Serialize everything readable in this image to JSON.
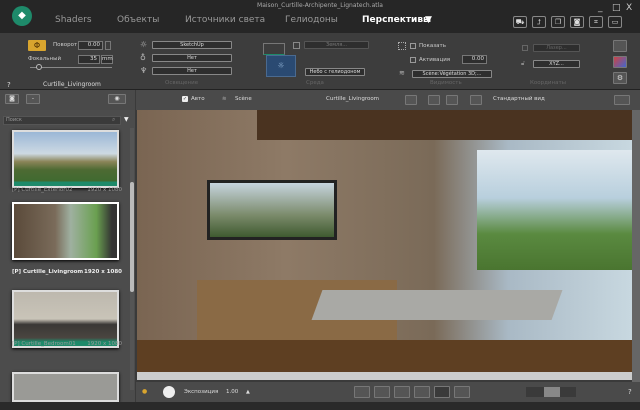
{
  "window": {
    "title": "Maison_Curtille-Archipente_Lignatech.atla",
    "controls": [
      "_",
      "□",
      "X"
    ]
  },
  "tabs": [
    {
      "label": "Shaders"
    },
    {
      "label": "Объекты"
    },
    {
      "label": "Источники света"
    },
    {
      "label": "Гелиодоны"
    },
    {
      "label": "Перспективы",
      "active": true
    }
  ],
  "tabs_menu": "▼",
  "camera": {
    "rotation_label": "Поворот",
    "rotation_value": "0.00",
    "focal_label": "Фокальный",
    "focal_value": "35",
    "focal_unit": "mm",
    "name": "Curtille_Livingroom",
    "help": "?"
  },
  "lighting": {
    "section": "Освещение",
    "preset": "SketchUp",
    "option2": "Нет",
    "option3": "Нет"
  },
  "environment": {
    "section": "Среда",
    "ground_button": "Земля...",
    "sky": "Небо с гелиодоном"
  },
  "visibility": {
    "section": "Видимость",
    "show_label": "Показать",
    "activation_label": "Активация",
    "activation_value": "0.00",
    "layer": "Scène:Végétation 3D;..."
  },
  "coordinates": {
    "section": "Координаты",
    "laser_button": "Лазер...",
    "xyz_button": "XYZ..."
  },
  "viewbar": {
    "auto_label": "Авто",
    "auto_checked": true,
    "scene_label": "Scène",
    "camera": "Curtille_Livingroom",
    "view": "Стандартный вид"
  },
  "left": {
    "search_placeholder": "Поиск",
    "items": [
      {
        "tag": "[P]",
        "name": "Curtille_Exterior02",
        "size": "1920 x 1080"
      },
      {
        "tag": "[P]",
        "name": "Curtille_Livingroom",
        "size": "1920 x 1080",
        "selected": true
      },
      {
        "tag": "[P]",
        "name": "Curtille_Bedroom01",
        "size": "1920 x 1080"
      }
    ]
  },
  "bottom": {
    "exposure_label": "Экспозиция",
    "exposure_value": "1.00",
    "help": "?"
  },
  "colors": {
    "accent": "#1e8a6a",
    "rotation_active": "#d9a52e"
  }
}
